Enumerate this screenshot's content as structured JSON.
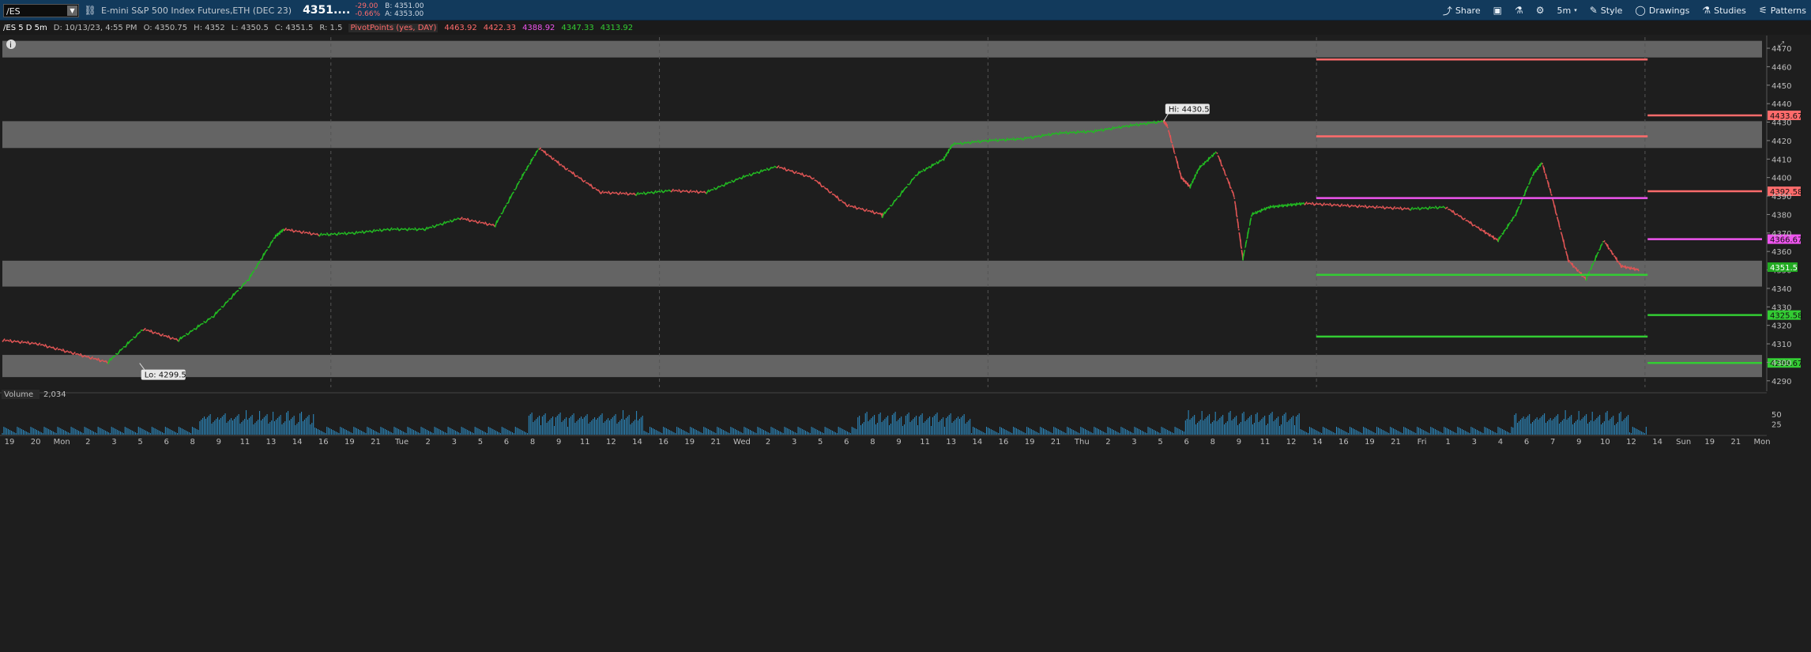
{
  "toolbar": {
    "symbol": "/ES",
    "description": "E-mini S&P 500 Index Futures,ETH (DEC 23)",
    "last_price": "4351....",
    "change": "-29.00",
    "change_pct": "-0.66%",
    "bid": "B: 4351.00",
    "ask": "A: 4353.00",
    "buttons": {
      "share": "Share",
      "timeframe": "5m",
      "style": "Style",
      "drawings": "Drawings",
      "studies": "Studies",
      "patterns": "Patterns"
    }
  },
  "info_bar": {
    "title": "/ES 5 D 5m",
    "date": "D: 10/13/23, 4:55 PM",
    "open": "O: 4350.75",
    "high": "H: 4352",
    "low": "L: 4350.5",
    "close": "C: 4351.5",
    "range": "R: 1.5",
    "study_name": "PivotPoints (yes, DAY)",
    "study_values": [
      {
        "text": "4463.92",
        "color": "#ff6b6b"
      },
      {
        "text": "4422.33",
        "color": "#ff6b6b"
      },
      {
        "text": "4388.92",
        "color": "#ee55ee"
      },
      {
        "text": "4347.33",
        "color": "#33cc33"
      },
      {
        "text": "4313.92",
        "color": "#33cc33"
      }
    ]
  },
  "colors": {
    "background": "#1e1e1e",
    "toolbar": "#123a5c",
    "up": "#22bb22",
    "down": "#e05555",
    "zone": "#6a6a6a",
    "pivot_resistance": "#ff6b6b",
    "pivot_mid": "#ee55ee",
    "pivot_support": "#33cc33",
    "volume": "#2e8fc7"
  },
  "chart_data": {
    "type": "line",
    "y_ticks": [
      4290,
      4300,
      4310,
      4320,
      4330,
      4340,
      4350,
      4360,
      4370,
      4380,
      4390,
      4400,
      4410,
      4420,
      4430,
      4440,
      4450,
      4460,
      4470
    ],
    "ylim": [
      4286.5,
      4476
    ],
    "x_ticks": [
      "19",
      "20",
      "Mon",
      "2",
      "3",
      "5",
      "6",
      "8",
      "9",
      "11",
      "13",
      "14",
      "16",
      "19",
      "21",
      "Tue",
      "2",
      "3",
      "5",
      "6",
      "8",
      "9",
      "11",
      "12",
      "14",
      "16",
      "19",
      "21",
      "Wed",
      "2",
      "3",
      "5",
      "6",
      "8",
      "9",
      "11",
      "13",
      "14",
      "16",
      "19",
      "21",
      "Thu",
      "2",
      "3",
      "5",
      "6",
      "8",
      "9",
      "11",
      "12",
      "14",
      "16",
      "19",
      "21",
      "Fri",
      "1",
      "3",
      "4",
      "6",
      "7",
      "9",
      "10",
      "12",
      "14",
      "Sun",
      "19",
      "21",
      "Mon"
    ],
    "price_series": {
      "name": "/ES",
      "x": [
        0,
        0.02,
        0.04,
        0.06,
        0.08,
        0.1,
        0.12,
        0.14,
        0.155,
        0.16,
        0.18,
        0.2,
        0.22,
        0.24,
        0.26,
        0.28,
        0.295,
        0.305,
        0.32,
        0.34,
        0.36,
        0.38,
        0.4,
        0.42,
        0.44,
        0.46,
        0.48,
        0.5,
        0.5,
        0.52,
        0.535,
        0.54,
        0.56,
        0.58,
        0.6,
        0.62,
        0.64,
        0.66,
        0.662,
        0.67,
        0.675,
        0.68,
        0.69,
        0.7,
        0.705,
        0.71,
        0.72,
        0.73,
        0.74,
        0.76,
        0.78,
        0.8,
        0.82,
        0.84,
        0.85,
        0.86,
        0.87,
        0.875,
        0.88,
        0.89,
        0.9,
        0.91,
        0.92,
        0.93
      ],
      "y": [
        4312,
        4310,
        4305,
        4300,
        4318,
        4312,
        4325,
        4345,
        4368,
        4372,
        4369,
        4370,
        4372,
        4372,
        4378,
        4374,
        4400,
        4416,
        4405,
        4392,
        4391,
        4393,
        4392,
        4400,
        4406,
        4400,
        4385,
        4380,
        4379,
        4402,
        4410,
        4418,
        4420,
        4421,
        4424,
        4425,
        4428,
        4430.5,
        4428,
        4400,
        4395,
        4405,
        4414,
        4390,
        4356,
        4380,
        4384,
        4385,
        4386,
        4385,
        4384,
        4383,
        4384,
        4372,
        4366,
        4380,
        4402,
        4408,
        4392,
        4355,
        4345,
        4366,
        4352,
        4350
      ]
    },
    "volume_series": {
      "name": "Volume",
      "value": "2,034",
      "y_ticks": [
        25,
        50
      ]
    },
    "zones": [
      {
        "low": 4465,
        "high": 4474
      },
      {
        "low": 4416,
        "high": 4430.5
      },
      {
        "low": 4341,
        "high": 4355
      },
      {
        "low": 4292,
        "high": 4304
      }
    ],
    "pivot_lines": [
      {
        "value": 4463.92,
        "color": "#ff6b6b"
      },
      {
        "value": 4422.33,
        "color": "#ff6b6b"
      },
      {
        "value": 4388.92,
        "color": "#ee55ee"
      },
      {
        "value": 4347.33,
        "color": "#33cc33"
      },
      {
        "value": 4313.92,
        "color": "#33cc33"
      }
    ],
    "next_pivots": [
      {
        "value": 4433.67,
        "label": "4433.67",
        "color": "#ff6b6b"
      },
      {
        "value": 4392.58,
        "label": "4392.58",
        "color": "#ff6b6b"
      },
      {
        "value": 4366.67,
        "label": "4366.67",
        "color": "#ee55ee"
      },
      {
        "value": 4325.58,
        "label": "4325.58",
        "color": "#33cc33"
      },
      {
        "value": 4299.67,
        "label": "4299.67",
        "color": "#33cc33"
      }
    ],
    "price_label": {
      "value": 4351.5,
      "label": "4351.5"
    },
    "annotations": [
      {
        "x": 0.66,
        "y": 4430.5,
        "text": "Hi: 4430.5"
      },
      {
        "x": 0.078,
        "y": 4299.5,
        "text": "Lo: 4299.5"
      }
    ],
    "grid": false
  }
}
